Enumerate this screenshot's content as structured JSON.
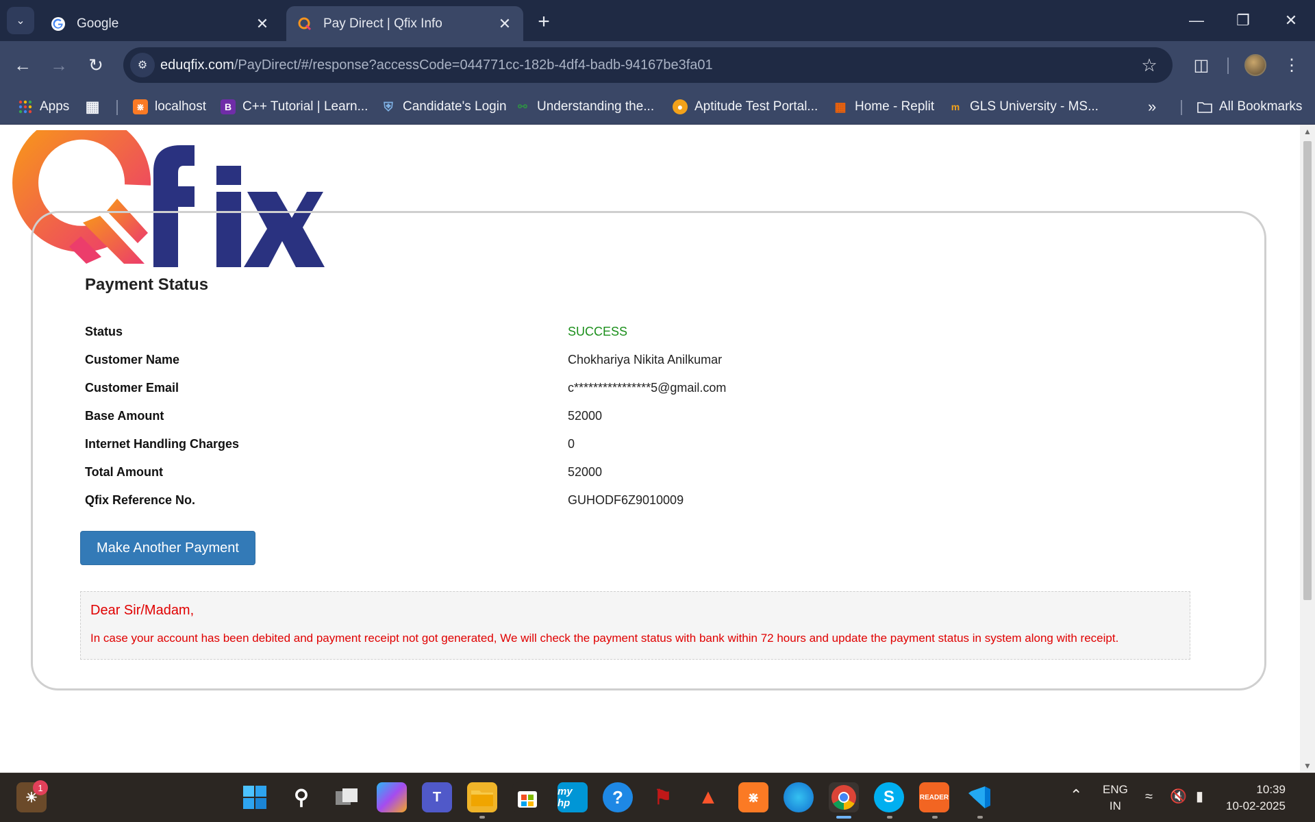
{
  "browser": {
    "tabs": [
      {
        "title": "Google",
        "favicon": "google-icon",
        "active": false
      },
      {
        "title": "Pay Direct | Qfix Info",
        "favicon": "qfix-icon",
        "active": true
      }
    ],
    "url_host": "eduqfix.com",
    "url_path": "/PayDirect/#/response?accessCode=044771cc-182b-4df4-badb-94167be3fa01",
    "bookmarks": [
      {
        "label": "Apps",
        "icon": "apps-grid-icon"
      },
      {
        "label": "localhost",
        "icon": "xampp-icon"
      },
      {
        "label": "C++ Tutorial | Learn...",
        "icon": "b-icon"
      },
      {
        "label": "Candidate's Login",
        "icon": "shield-icon"
      },
      {
        "label": "Understanding the...",
        "icon": "gfg-icon"
      },
      {
        "label": "Aptitude Test Portal...",
        "icon": "aptitude-icon"
      },
      {
        "label": "Home - Replit",
        "icon": "replit-icon"
      },
      {
        "label": "GLS University - MS...",
        "icon": "gls-icon"
      },
      {
        "label": "All Bookmarks",
        "icon": "folder-icon"
      }
    ]
  },
  "page": {
    "logo_text": "Qfix",
    "heading": "Payment Status",
    "rows": [
      {
        "label": "Status",
        "value": "SUCCESS"
      },
      {
        "label": "Customer Name",
        "value": "Chokhariya Nikita Anilkumar"
      },
      {
        "label": "Customer Email",
        "value": "c****************5@gmail.com"
      },
      {
        "label": "Base Amount",
        "value": "52000"
      },
      {
        "label": "Internet Handling Charges",
        "value": "0"
      },
      {
        "label": "Total Amount",
        "value": "52000"
      },
      {
        "label": "Qfix Reference No.",
        "value": "GUHODF6Z9010009"
      }
    ],
    "button_label": "Make Another Payment",
    "notice_greeting": "Dear Sir/Madam,",
    "notice_message": "In case your account has been debited and payment receipt not got generated, We will check the payment status with bank within 72 hours and update the payment status in system along with receipt."
  },
  "taskbar": {
    "weather_badge": "1",
    "lang_top": "ENG",
    "lang_bottom": "IN",
    "time": "10:39",
    "date": "10-02-2025"
  },
  "colors": {
    "status_success": "#1b8f1b",
    "notice_text": "#e00000",
    "button_bg": "#337ab7",
    "logo_navy": "#2a3280",
    "logo_orange": "#f7941d",
    "logo_pink": "#ec3d6b"
  }
}
